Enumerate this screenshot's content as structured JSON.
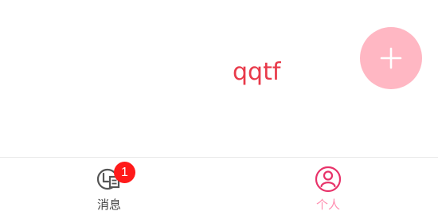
{
  "main": {
    "text": "qqtf",
    "text_color": "#e83a4a"
  },
  "fab": {
    "icon": "plus-icon",
    "color": "#ffb7c3"
  },
  "tabbar": {
    "tabs": [
      {
        "label": "消息",
        "icon": "message-icon",
        "badge": "1",
        "active": false
      },
      {
        "label": "个人",
        "icon": "person-icon",
        "active": true
      }
    ],
    "active_color": "#ff8fb1",
    "badge_color": "#ff1a1a"
  }
}
